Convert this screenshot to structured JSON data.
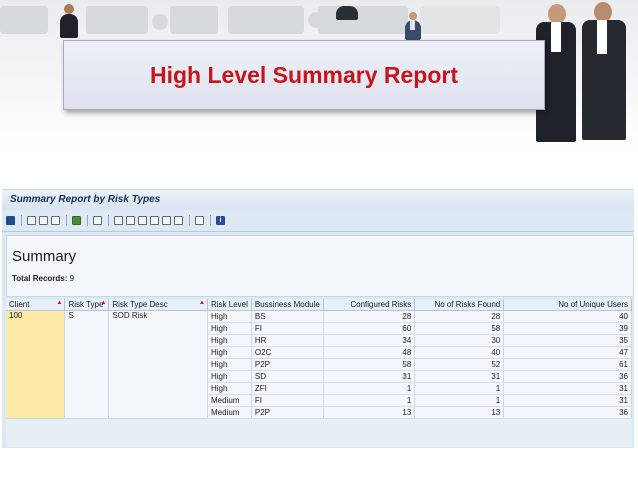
{
  "banner": {
    "title": "High Level Summary Report"
  },
  "report": {
    "window_title": "Summary Report by Risk Types",
    "toolbar_icons": [
      "details-icon",
      "print-icon",
      "filter-icon",
      "filter-set-icon",
      "sum-icon",
      "refresh-icon",
      "export-icon",
      "send-icon",
      "local-file-icon",
      "layout-icon",
      "select-layout-icon",
      "save-layout-icon",
      "graphic-icon",
      "info-icon"
    ],
    "summary_heading": "Summary",
    "total_records_label": "Total Records:",
    "total_records_value": "9",
    "columns": [
      "Client",
      "Risk Type",
      "Risk Type Desc",
      "Risk Level",
      "Bussiness Module",
      "Configured Risks",
      "No of Risks Found",
      "No of Unique Users"
    ],
    "group": {
      "client": "100",
      "risk_type": "S",
      "risk_type_desc": "SOD Risk"
    },
    "rows": [
      {
        "level": "High",
        "module": "BS",
        "configured": "28",
        "found": "28",
        "users": "40"
      },
      {
        "level": "High",
        "module": "FI",
        "configured": "60",
        "found": "58",
        "users": "39"
      },
      {
        "level": "High",
        "module": "HR",
        "configured": "34",
        "found": "30",
        "users": "35"
      },
      {
        "level": "High",
        "module": "O2C",
        "configured": "48",
        "found": "40",
        "users": "47"
      },
      {
        "level": "High",
        "module": "P2P",
        "configured": "58",
        "found": "52",
        "users": "61"
      },
      {
        "level": "High",
        "module": "SD",
        "configured": "31",
        "found": "31",
        "users": "36"
      },
      {
        "level": "High",
        "module": "ZFI",
        "configured": "1",
        "found": "1",
        "users": "31"
      },
      {
        "level": "Medium",
        "module": "FI",
        "configured": "1",
        "found": "1",
        "users": "31"
      },
      {
        "level": "Medium",
        "module": "P2P",
        "configured": "13",
        "found": "13",
        "users": "36"
      }
    ],
    "accent": "#c4161c"
  }
}
